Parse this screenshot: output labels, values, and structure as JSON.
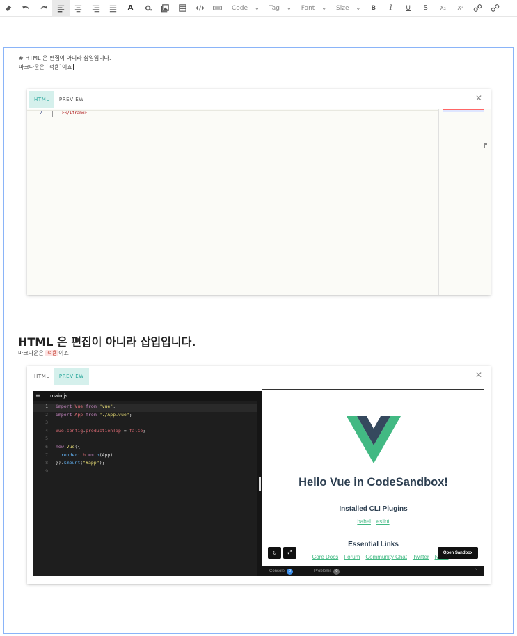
{
  "toolbar": {
    "icons": [
      "eraser-icon",
      "undo-icon",
      "redo-icon",
      "align-left-icon",
      "align-center-icon",
      "align-right-icon",
      "align-justify-icon",
      "font-color-icon",
      "fill-color-icon",
      "image-icon",
      "table-icon",
      "code-icon",
      "embed-icon"
    ],
    "font_color_label": "A",
    "code_label": "Code",
    "tag_label": "Tag",
    "font_label": "Font",
    "size_label": "Size",
    "bold_label": "B",
    "italic_label": "I",
    "underline_label": "U",
    "strike_label": "S",
    "subscript_label": "X₂",
    "superscript_label": "X²"
  },
  "markdown": {
    "line1": "# HTML 은 편집이 아니라 삽입입니다.",
    "line2": "마크다운은 `적용`이죠"
  },
  "code_card": {
    "tab_html": "HTML",
    "tab_preview": "PREVIEW",
    "close": "✕",
    "line_number": "7",
    "line_code": "></iframe>"
  },
  "rendered": {
    "heading": "HTML 은 편집이 아니라 삽입입니다.",
    "sub_before": "마크다운은 ",
    "sub_code": "적용",
    "sub_after": "이죠"
  },
  "preview_card": {
    "tab_html": "HTML",
    "tab_preview": "PREVIEW",
    "close": "✕",
    "file_name": "main.js",
    "code_lines": [
      {
        "n": "1",
        "html": "<span class='kw'>import</span> <span class='var'>Vue</span> <span class='kw'>from</span> <span class='str'>\"vue\"</span><span class='pn'>;</span>"
      },
      {
        "n": "2",
        "html": "<span class='kw'>import</span> <span class='var'>App</span> <span class='kw'>from</span> <span class='str'>\"./App.vue\"</span><span class='pn'>;</span>"
      },
      {
        "n": "3",
        "html": ""
      },
      {
        "n": "4",
        "html": "<span class='var'>Vue</span><span class='pn'>.</span><span class='var'>config</span><span class='pn'>.</span><span class='var'>productionTip</span> <span class='pn'>=</span> <span class='bool'>false</span><span class='pn'>;</span>"
      },
      {
        "n": "5",
        "html": ""
      },
      {
        "n": "6",
        "html": "<span class='kw'>new</span> <span class='str'>Vue</span><span class='pn'>({</span>"
      },
      {
        "n": "7",
        "html": "  <span class='fnc'>render</span><span class='pn'>:</span> <span class='var'>h</span> <span class='kw'>=&gt;</span> <span class='fnc'>h</span><span class='pn'>(App)</span>"
      },
      {
        "n": "8",
        "html": "<span class='pn'>}).</span><span class='fnc'>$mount</span><span class='pn'>(</span><span class='str'>\"#app\"</span><span class='pn'>);</span>"
      },
      {
        "n": "9",
        "html": ""
      }
    ],
    "vue_title": "Hello Vue in CodeSandbox!",
    "installed_title": "Installed CLI Plugins",
    "plugins": [
      "babel",
      "eslint"
    ],
    "essential_title": "Essential Links",
    "essential_links": [
      "Core Docs",
      "Forum",
      "Community Chat",
      "Twitter",
      "News"
    ],
    "open_sandbox": "Open Sandbox",
    "console_label": "Console",
    "console_count": "0",
    "problems_label": "Problems",
    "problems_count": "0",
    "caret": "^"
  },
  "colors": {
    "accent": "#26a69a",
    "vue_green": "#42b983",
    "vue_dark": "#35495e",
    "editor_border": "#8ab4f8"
  }
}
